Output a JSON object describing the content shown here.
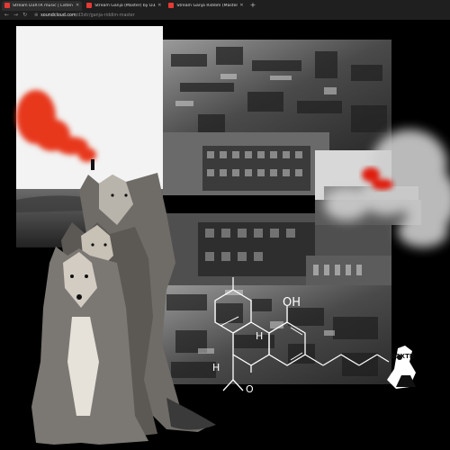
{
  "browser": {
    "tabs": [
      {
        "label": "Stream D3XTR music | Listen",
        "active": true
      },
      {
        "label": "Stream Ganja (Master) by D3XT",
        "active": false
      },
      {
        "label": "Stream Ganja Riddim (Master)",
        "active": false
      }
    ],
    "new_tab_label": "+",
    "url_host": "soundcloud.com",
    "url_path": "/d3xtr/ganja-riddim-master"
  },
  "artwork": {
    "molecule_labels": {
      "oh": "OH",
      "h1": "H",
      "h2": "H",
      "o": "O"
    },
    "logo_text": "D3XTR",
    "colors": {
      "background": "#000000",
      "smoke": "#e8381c",
      "line": "#ffffff"
    }
  }
}
